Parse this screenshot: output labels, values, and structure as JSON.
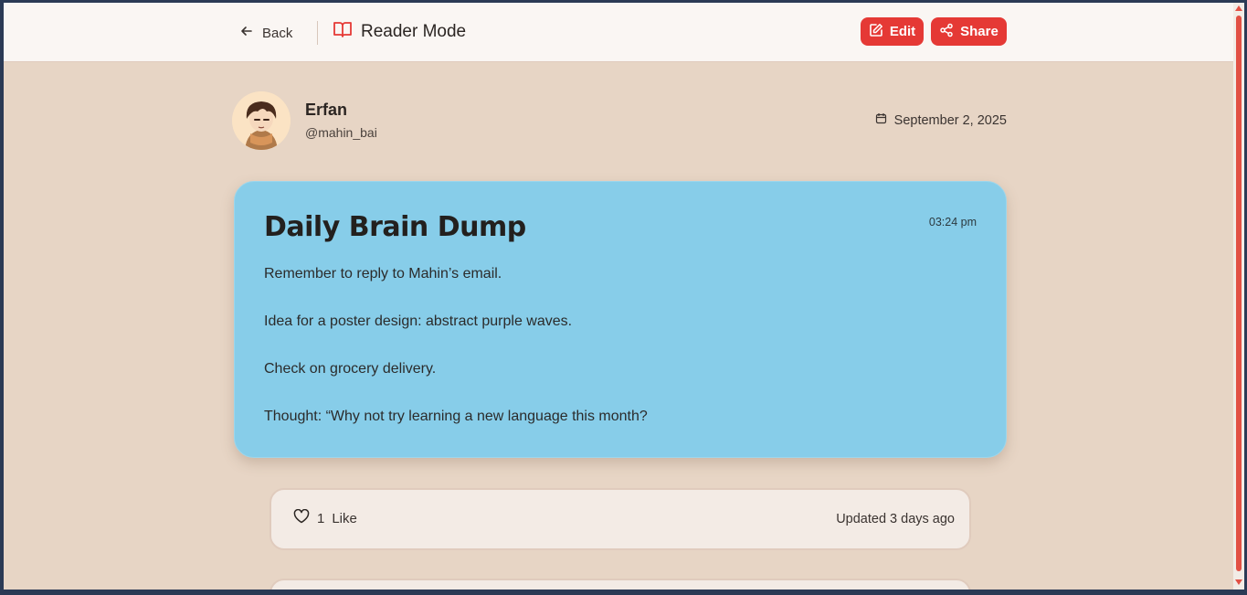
{
  "header": {
    "back_label": "Back",
    "title": "Reader Mode",
    "edit_label": "Edit",
    "share_label": "Share"
  },
  "author": {
    "name": "Erfan",
    "handle": "@mahin_bai",
    "date": "September 2, 2025"
  },
  "note": {
    "title": "Daily Brain Dump",
    "time": "03:24 pm",
    "lines": [
      "Remember to reply to Mahin’s email.",
      "Idea for a poster design: abstract purple waves.",
      "Check on grocery delivery.",
      "Thought: “Why not try learning a new language this month?"
    ],
    "background_color": "#87cde9"
  },
  "engagement": {
    "like_count": "1",
    "like_label": "Like",
    "updated": "Updated 3 days ago"
  },
  "colors": {
    "accent": "#e53935",
    "page_bg": "#e7d5c5",
    "header_bg": "#faf6f3"
  }
}
